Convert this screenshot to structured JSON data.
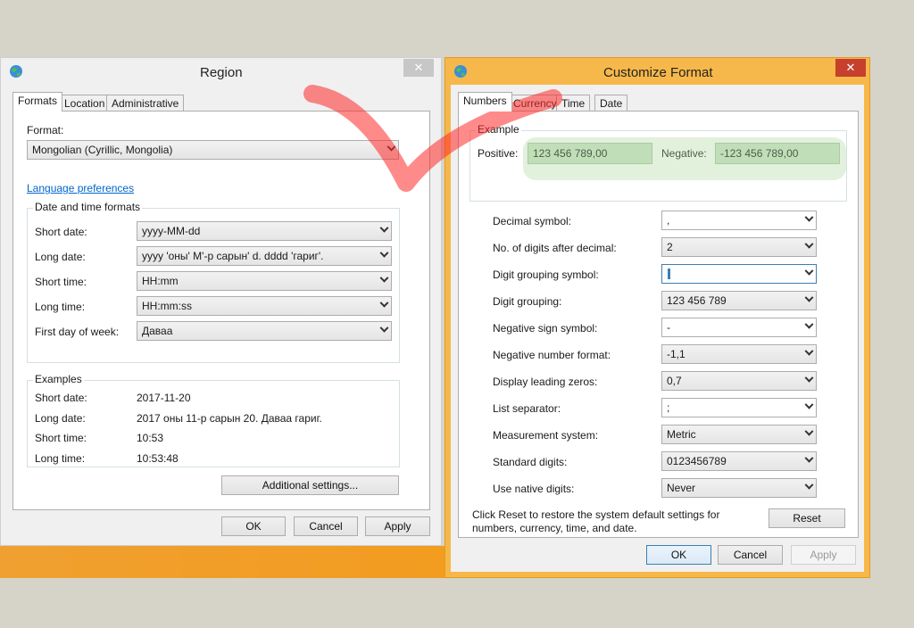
{
  "region": {
    "title": "Region",
    "close_glyph": "✕",
    "tabs": [
      "Formats",
      "Location",
      "Administrative"
    ],
    "format_label": "Format:",
    "format_value": "Mongolian (Cyrillic, Mongolia)",
    "language_link": "Language preferences",
    "dt_group_title": "Date and time formats",
    "dt_rows": [
      {
        "label": "Short date:",
        "value": "yyyy-MM-dd"
      },
      {
        "label": "Long date:",
        "value": "yyyy 'оны' M'-р сарын' d. dddd 'гариг'."
      },
      {
        "label": "Short time:",
        "value": "HH:mm"
      },
      {
        "label": "Long time:",
        "value": "HH:mm:ss"
      },
      {
        "label": "First day of week:",
        "value": "Даваа"
      }
    ],
    "examples_title": "Examples",
    "examples": [
      {
        "label": "Short date:",
        "value": "2017-11-20"
      },
      {
        "label": "Long date:",
        "value": "2017 оны 11-р сарын 20. Даваа гариг."
      },
      {
        "label": "Short time:",
        "value": "10:53"
      },
      {
        "label": "Long time:",
        "value": "10:53:48"
      }
    ],
    "additional_btn": "Additional settings...",
    "ok_btn": "OK",
    "cancel_btn": "Cancel",
    "apply_btn": "Apply"
  },
  "customize": {
    "title": "Customize Format",
    "close_glyph": "✕",
    "tabs": [
      "Numbers",
      "Currency",
      "Time",
      "Date"
    ],
    "example_title": "Example",
    "positive_label": "Positive:",
    "positive_value": "123 456 789,00",
    "negative_label": "Negative:",
    "negative_value": "-123 456 789,00",
    "settings": [
      {
        "label": "Decimal symbol:",
        "value": ","
      },
      {
        "label": "No. of digits after decimal:",
        "value": "2"
      },
      {
        "label": "Digit grouping symbol:",
        "value": ""
      },
      {
        "label": "Digit grouping:",
        "value": "123 456 789"
      },
      {
        "label": "Negative sign symbol:",
        "value": "-"
      },
      {
        "label": "Negative number format:",
        "value": "-1,1"
      },
      {
        "label": "Display leading zeros:",
        "value": "0,7"
      },
      {
        "label": "List separator:",
        "value": ";"
      },
      {
        "label": "Measurement system:",
        "value": "Metric"
      },
      {
        "label": "Standard digits:",
        "value": "0123456789"
      },
      {
        "label": "Use native digits:",
        "value": "Never"
      }
    ],
    "reset_note_line1": "Click Reset to restore the system default settings for",
    "reset_note_line2": "numbers, currency, time, and date.",
    "reset_btn": "Reset",
    "ok_btn": "OK",
    "cancel_btn": "Cancel",
    "apply_btn": "Apply"
  },
  "colors": {
    "accent_window": "#f6b84a",
    "highlight_green": "#cde3c8",
    "annotation_red": "#ff2a2a"
  }
}
